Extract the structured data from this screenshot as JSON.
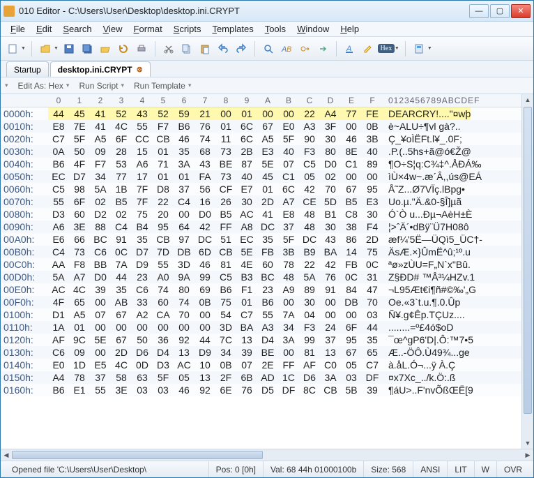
{
  "title": "010 Editor - C:\\Users\\User\\Desktop\\desktop.ini.CRYPT",
  "menus": [
    "File",
    "Edit",
    "Search",
    "View",
    "Format",
    "Scripts",
    "Templates",
    "Tools",
    "Window",
    "Help"
  ],
  "tabs": [
    {
      "label": "Startup",
      "active": false,
      "closable": false
    },
    {
      "label": "desktop.ini.CRYPT",
      "active": true,
      "closable": true
    }
  ],
  "editbar": {
    "editAs": "Edit As: Hex",
    "runScript": "Run Script",
    "runTemplate": "Run Template"
  },
  "hexHeader": [
    "0",
    "1",
    "2",
    "3",
    "4",
    "5",
    "6",
    "7",
    "8",
    "9",
    "A",
    "B",
    "C",
    "D",
    "E",
    "F"
  ],
  "ascHeader": "0123456789ABCDEF",
  "rows": [
    {
      "a": "0000h:",
      "b": [
        "44",
        "45",
        "41",
        "52",
        "43",
        "52",
        "59",
        "21",
        "00",
        "01",
        "00",
        "00",
        "22",
        "A4",
        "77",
        "FE"
      ],
      "t": "DEARCRY!....\"¤wþ",
      "hl": true
    },
    {
      "a": "0010h:",
      "b": [
        "E8",
        "7E",
        "41",
        "4C",
        "55",
        "F7",
        "B6",
        "76",
        "01",
        "6C",
        "67",
        "E0",
        "A3",
        "3F",
        "00",
        "0B"
      ],
      "t": "è~ALU÷¶vl gà?.."
    },
    {
      "a": "0020h:",
      "b": [
        "C7",
        "5F",
        "A5",
        "6F",
        "CC",
        "CB",
        "46",
        "74",
        "11",
        "6C",
        "A5",
        "5F",
        "90",
        "30",
        "46",
        "3B"
      ],
      "t": "Ç_¥oÌËFt.l¥_.0F;"
    },
    {
      "a": "0030h:",
      "b": [
        "0A",
        "50",
        "09",
        "28",
        "15",
        "01",
        "35",
        "68",
        "73",
        "2B",
        "E3",
        "40",
        "F3",
        "80",
        "8E",
        "40"
      ],
      "t": ".P.(..5hs+ã@ó€Ž@"
    },
    {
      "a": "0040h:",
      "b": [
        "B6",
        "4F",
        "F7",
        "53",
        "A6",
        "71",
        "3A",
        "43",
        "BE",
        "87",
        "5E",
        "07",
        "C5",
        "D0",
        "C1",
        "89"
      ],
      "t": "¶O÷S¦q:C¾‡^.ÅÐÁ‰"
    },
    {
      "a": "0050h:",
      "b": [
        "EC",
        "D7",
        "34",
        "77",
        "17",
        "01",
        "01",
        "FA",
        "73",
        "40",
        "45",
        "C1",
        "05",
        "02",
        "00",
        "00"
      ],
      "t": "ìÙ×4w~.æ´Â,,ús@EÁ"
    },
    {
      "a": "0060h:",
      "b": [
        "C5",
        "98",
        "5A",
        "1B",
        "7F",
        "D8",
        "37",
        "56",
        "CF",
        "E7",
        "01",
        "6C",
        "42",
        "70",
        "67",
        "95"
      ],
      "t": "Å˜Z...Ø7VÏç.lBpg•"
    },
    {
      "a": "0070h:",
      "b": [
        "55",
        "6F",
        "02",
        "B5",
        "7F",
        "22",
        "C4",
        "16",
        "26",
        "30",
        "2D",
        "A7",
        "CE",
        "5D",
        "B5",
        "E3"
      ],
      "t": "Uo.µ.\"Ä.&0-§Î]µã"
    },
    {
      "a": "0080h:",
      "b": [
        "D3",
        "60",
        "D2",
        "02",
        "75",
        "20",
        "00",
        "D0",
        "B5",
        "AC",
        "41",
        "E8",
        "48",
        "B1",
        "C8",
        "30"
      ],
      "t": "Ó`Ò u...Ðµ¬AèH±È"
    },
    {
      "a": "0090h:",
      "b": [
        "A6",
        "3E",
        "88",
        "C4",
        "B4",
        "95",
        "64",
        "42",
        "FF",
        "A8",
        "DC",
        "37",
        "48",
        "30",
        "38",
        "F4"
      ],
      "t": "¦>ˆÄ´•dBÿ¨Ü7H08ô"
    },
    {
      "a": "00A0h:",
      "b": [
        "E6",
        "66",
        "BC",
        "91",
        "35",
        "CB",
        "97",
        "DC",
        "51",
        "EC",
        "35",
        "5F",
        "DC",
        "43",
        "86",
        "2D"
      ],
      "t": "æf¼'5Ë—ÜQì5_ÜC†-"
    },
    {
      "a": "00B0h:",
      "b": [
        "C4",
        "73",
        "C6",
        "0C",
        "D7",
        "7D",
        "DB",
        "6D",
        "CB",
        "5E",
        "FB",
        "3B",
        "B9",
        "BA",
        "14",
        "75"
      ],
      "t": "ÄsÆ.×}ÛmË^û;¹º.u"
    },
    {
      "a": "00C0h:",
      "b": [
        "AA",
        "F8",
        "BB",
        "7A",
        "D9",
        "55",
        "3D",
        "46",
        "81",
        "4E",
        "60",
        "78",
        "22",
        "42",
        "FB",
        "0C"
      ],
      "t": "ªø»zÙU=F„N`x\"Bû."
    },
    {
      "a": "00D0h:",
      "b": [
        "5A",
        "A7",
        "D0",
        "44",
        "23",
        "A0",
        "9A",
        "99",
        "C5",
        "B3",
        "BC",
        "48",
        "5A",
        "76",
        "0C",
        "31"
      ],
      "t": "Z§ÐD# ™Å³¼HZv.1"
    },
    {
      "a": "00E0h:",
      "b": [
        "AC",
        "4C",
        "39",
        "35",
        "C6",
        "74",
        "80",
        "69",
        "B6",
        "F1",
        "23",
        "A9",
        "89",
        "91",
        "84",
        "47"
      ],
      "t": "¬L95Æt€i¶ñ#©‰'„G"
    },
    {
      "a": "00F0h:",
      "b": [
        "4F",
        "65",
        "00",
        "AB",
        "33",
        "60",
        "74",
        "0B",
        "75",
        "01",
        "B6",
        "00",
        "30",
        "00",
        "DB",
        "70"
      ],
      "t": "Oe.«3`t.u.¶.0.Ûp"
    },
    {
      "a": "0100h:",
      "b": [
        "D1",
        "A5",
        "07",
        "67",
        "A2",
        "CA",
        "70",
        "00",
        "54",
        "C7",
        "55",
        "7A",
        "04",
        "00",
        "00",
        "03"
      ],
      "t": "Ñ¥.g¢Êp.TÇUz...."
    },
    {
      "a": "0110h:",
      "b": [
        "1A",
        "01",
        "00",
        "00",
        "00",
        "00",
        "00",
        "00",
        "3D",
        "BA",
        "A3",
        "34",
        "F3",
        "24",
        "6F",
        "44"
      ],
      "t": "........=º£4ó$oD"
    },
    {
      "a": "0120h:",
      "b": [
        "AF",
        "9C",
        "5E",
        "67",
        "50",
        "36",
        "92",
        "44",
        "7C",
        "13",
        "D4",
        "3A",
        "99",
        "37",
        "95",
        "35"
      ],
      "t": "¯œ^gP6'D|.Ô:™7•5"
    },
    {
      "a": "0130h:",
      "b": [
        "C6",
        "09",
        "00",
        "2D",
        "D6",
        "D4",
        "13",
        "D9",
        "34",
        "39",
        "BE",
        "00",
        "81",
        "13",
        "67",
        "65"
      ],
      "t": "Æ..-ÖÔ.Ù49¾...ge"
    },
    {
      "a": "0140h:",
      "b": [
        "E0",
        "1D",
        "E5",
        "4C",
        "0D",
        "D3",
        "AC",
        "10",
        "0B",
        "07",
        "2E",
        "FF",
        "AF",
        "C0",
        "05",
        "C7"
      ],
      "t": "à.åL.Ó¬...ÿ À.Ç"
    },
    {
      "a": "0150h:",
      "b": [
        "A4",
        "78",
        "37",
        "58",
        "63",
        "5F",
        "05",
        "13",
        "2F",
        "6B",
        "AD",
        "1C",
        "D6",
        "3A",
        "03",
        "DF"
      ],
      "t": "¤x7Xc_../k­.Ö:.ß"
    },
    {
      "a": "0160h:",
      "b": [
        "B6",
        "E1",
        "55",
        "3E",
        "03",
        "03",
        "46",
        "92",
        "6E",
        "76",
        "D5",
        "DF",
        "8C",
        "CB",
        "5B",
        "39"
      ],
      "t": "¶áU>..F'nvÕßŒË[9"
    }
  ],
  "status": {
    "file": "Opened file 'C:\\Users\\User\\Desktop\\",
    "pos": "Pos: 0 [0h]",
    "val": "Val: 68 44h 01000100b",
    "size": "Size: 568",
    "enc": "ANSI",
    "lit": "LIT",
    "w": "W",
    "ovr": "OVR"
  },
  "chart_data": null
}
